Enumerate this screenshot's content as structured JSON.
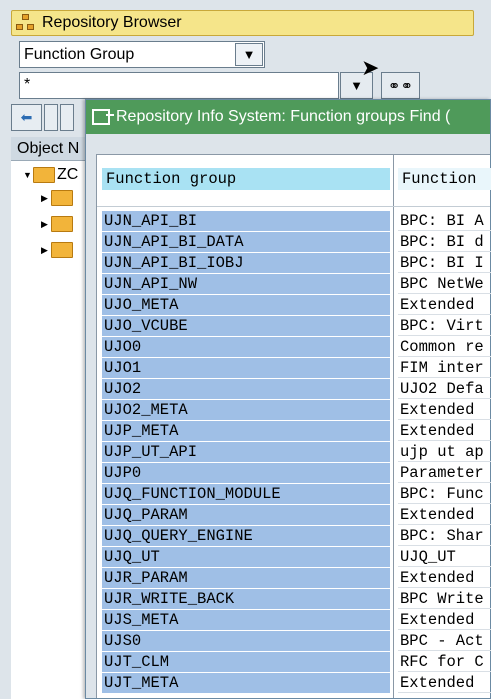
{
  "browser": {
    "title": "Repository Browser",
    "object_type": "Function Group",
    "search_value": "*",
    "object_header": "Object N",
    "tree_root_label": "ZC"
  },
  "dialog": {
    "title": "Repository Info System: Function groups Find (",
    "columns": [
      "Function group",
      "Function"
    ],
    "rows": [
      {
        "name": "UJN_API_BI",
        "desc": "BPC: BI A"
      },
      {
        "name": "UJN_API_BI_DATA",
        "desc": "BPC: BI d"
      },
      {
        "name": "UJN_API_BI_IOBJ",
        "desc": "BPC: BI I"
      },
      {
        "name": "UJN_API_NW",
        "desc": "BPC NetWe"
      },
      {
        "name": "UJO_META",
        "desc": "Extended"
      },
      {
        "name": "UJO_VCUBE",
        "desc": "BPC: Virt"
      },
      {
        "name": "UJO0",
        "desc": "Common re"
      },
      {
        "name": "UJO1",
        "desc": "FIM inter"
      },
      {
        "name": "UJO2",
        "desc": "UJO2 Defa"
      },
      {
        "name": "UJO2_META",
        "desc": "Extended"
      },
      {
        "name": "UJP_META",
        "desc": "Extended"
      },
      {
        "name": "UJP_UT_API",
        "desc": "ujp ut ap"
      },
      {
        "name": "UJP0",
        "desc": "Parameter"
      },
      {
        "name": "UJQ_FUNCTION_MODULE",
        "desc": "BPC: Func"
      },
      {
        "name": "UJQ_PARAM",
        "desc": "Extended"
      },
      {
        "name": "UJQ_QUERY_ENGINE",
        "desc": "BPC: Shar"
      },
      {
        "name": "UJQ_UT",
        "desc": "UJQ_UT"
      },
      {
        "name": "UJR_PARAM",
        "desc": "Extended"
      },
      {
        "name": "UJR_WRITE_BACK",
        "desc": "BPC Write"
      },
      {
        "name": "UJS_META",
        "desc": "Extended"
      },
      {
        "name": "UJS0",
        "desc": "BPC - Act"
      },
      {
        "name": "UJT_CLM",
        "desc": "RFC for C"
      },
      {
        "name": "UJT_META",
        "desc": "Extended"
      }
    ]
  },
  "colors": {
    "title_bar": "#f5e58a",
    "dialog_title": "#4f9a5a",
    "selected_cell": "#9fbfe6",
    "header_cell": "#a9e2f3"
  },
  "icons": [
    "tree-icon",
    "chevron-down-icon",
    "glasses-icon",
    "back-arrow-icon",
    "folder-icon",
    "dialog-icon",
    "cursor-icon"
  ]
}
